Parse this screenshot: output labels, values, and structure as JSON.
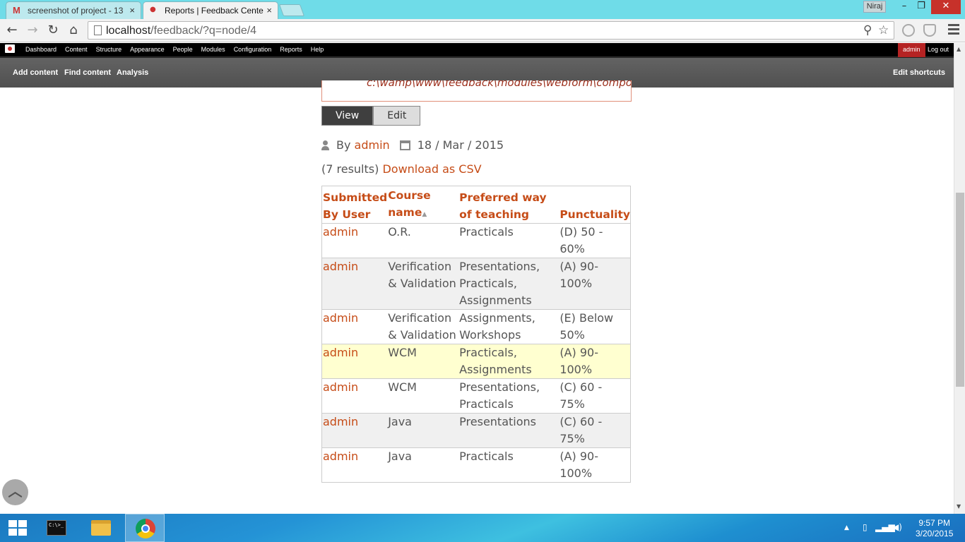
{
  "browser": {
    "tabs": [
      {
        "title": "screenshot of project - 13",
        "close": "×"
      },
      {
        "title": "Reports | Feedback Cente",
        "close": "×"
      }
    ],
    "profile_name": "Niraj",
    "url_host": "localhost",
    "url_path": "/feedback/?q=node/4"
  },
  "admin_bar": {
    "menu": [
      "Dashboard",
      "Content",
      "Structure",
      "Appearance",
      "People",
      "Modules",
      "Configuration",
      "Reports",
      "Help"
    ],
    "user": "admin",
    "logout": "Log out"
  },
  "shortcuts": {
    "items": [
      "Add content",
      "Find content",
      "Analysis"
    ],
    "edit": "Edit shortcuts"
  },
  "page": {
    "error_fragment": "c:\\wamp\\www\\feedback\\modules\\webform\\components\\select.inc).",
    "tabs": [
      "View",
      "Edit"
    ],
    "by_label": "By",
    "author": "admin",
    "date": "18 / Mar / 2015",
    "results_count": "(7 results)",
    "download_link": "Download as CSV"
  },
  "table": {
    "headers": [
      "Submitted By User",
      "Course name",
      "Preferred way of teaching",
      "Punctuality"
    ],
    "sort_indicator": "▲",
    "rows": [
      {
        "user": "admin",
        "course": "O.R.",
        "teaching": "Practicals",
        "punctuality": "(D) 50 - 60%"
      },
      {
        "user": "admin",
        "course": "Verification & Validation",
        "teaching": "Presentations, Practicals, Assignments",
        "punctuality": "(A) 90-100%"
      },
      {
        "user": "admin",
        "course": "Verification & Validation",
        "teaching": "Assignments, Workshops",
        "punctuality": "(E) Below 50%"
      },
      {
        "user": "admin",
        "course": "WCM",
        "teaching": "Practicals, Assignments",
        "punctuality": "(A) 90-100%"
      },
      {
        "user": "admin",
        "course": "WCM",
        "teaching": "Presentations, Practicals",
        "punctuality": "(C) 60 - 75%"
      },
      {
        "user": "admin",
        "course": "Java",
        "teaching": "Presentations",
        "punctuality": "(C) 60 - 75%"
      },
      {
        "user": "admin",
        "course": "Java",
        "teaching": "Practicals",
        "punctuality": "(A) 90-100%"
      }
    ]
  },
  "taskbar": {
    "cmd_label": "C:\\>_",
    "time": "9:57 PM",
    "date": "3/20/2015"
  }
}
